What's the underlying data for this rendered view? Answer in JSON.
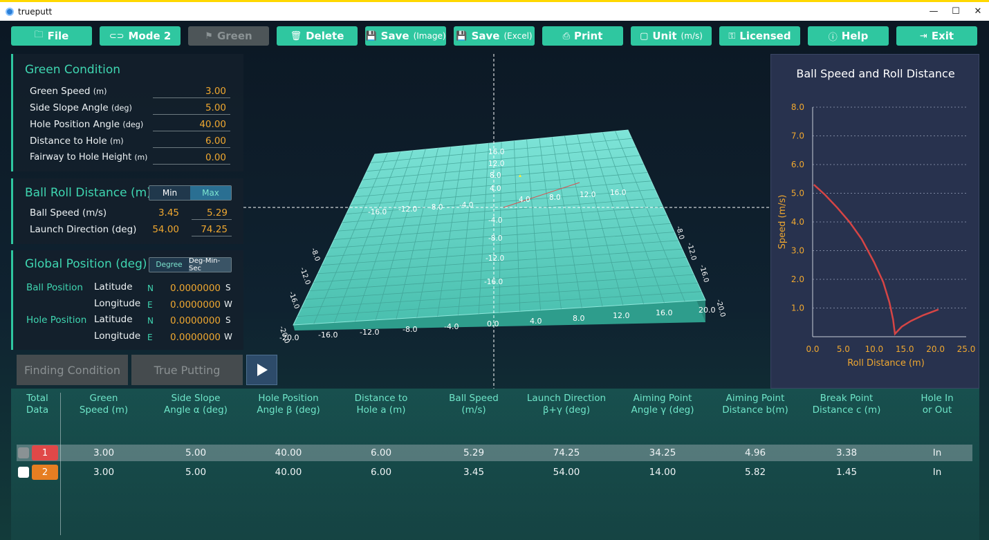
{
  "window": {
    "title": "trueputt",
    "controls": [
      "—",
      "☐",
      "✕"
    ]
  },
  "toolbar": {
    "file": "File",
    "mode": "Mode 2",
    "green": "Green",
    "delete": "Delete",
    "save_image": "Save",
    "save_image_sub": "(Image)",
    "save_excel": "Save",
    "save_excel_sub": "(Excel)",
    "print": "Print",
    "unit": "Unit",
    "unit_sub": "(m/s)",
    "licensed": "Licensed",
    "help": "Help",
    "exit": "Exit"
  },
  "green_condition": {
    "title": "Green Condition",
    "fields": [
      {
        "label": "Green Speed",
        "unit": "(m)",
        "value": "3.00"
      },
      {
        "label": "Side Slope Angle",
        "unit": "(deg)",
        "value": "5.00"
      },
      {
        "label": "Hole Position Angle",
        "unit": "(deg)",
        "value": "40.00"
      },
      {
        "label": "Distance to Hole",
        "unit": "(m)",
        "value": "6.00"
      },
      {
        "label": "Fairway to Hole Height",
        "unit": "(m)",
        "value": "0.00"
      }
    ]
  },
  "ball_roll": {
    "title": "Ball Roll Distance (m)",
    "min_label": "Min",
    "max_label": "Max",
    "rows": [
      {
        "label": "Ball Speed (m/s)",
        "min": "3.45",
        "max": "5.29"
      },
      {
        "label": "Launch Direction (deg)",
        "min": "54.00",
        "max": "74.25"
      }
    ]
  },
  "global_position": {
    "title": "Global Position (deg)",
    "degree_label": "Degree",
    "dms_label": "Deg-Min-Sec",
    "ball_label": "Ball Position",
    "hole_label": "Hole Position",
    "latitude": "Latitude",
    "longitude": "Longitude",
    "N": "N",
    "E": "E",
    "S": "S",
    "W": "W",
    "ball_lat": "0.0000000",
    "ball_lon": "0.0000000",
    "hole_lat": "0.0000000",
    "hole_lon": "0.0000000"
  },
  "actions": {
    "finding": "Finding Condition",
    "true_putting": "True Putting"
  },
  "view3d": {
    "x_labels": [
      "-20.0",
      "-16.0",
      "-12.0",
      "-8.0",
      "-4.0",
      "0.0",
      "4.0",
      "8.0",
      "12.0",
      "16.0",
      "20.0"
    ],
    "inner_x": [
      "-16.0",
      "-12.0",
      "-8.0",
      "-4.0",
      "4.0",
      "8.0",
      "12.0",
      "16.0"
    ],
    "inner_y": [
      "16.0",
      "12.0",
      "8.0",
      "4.0",
      "-4.0",
      "-8.0",
      "-12.0",
      "-16.0"
    ],
    "left_edge": [
      "-20.0",
      "-16.0",
      "-12.0",
      "-8.0"
    ],
    "right_edge": [
      "-20.0",
      "-16.0",
      "-12.0",
      "-8.0",
      "8",
      "12",
      "16"
    ]
  },
  "chart_data": {
    "type": "line",
    "title": "Ball Speed and Roll Distance",
    "xlabel": "Roll Distance (m)",
    "ylabel": "Speed (m/s)",
    "xlim": [
      0,
      25
    ],
    "ylim": [
      0,
      8
    ],
    "xticks": [
      "0.0",
      "5.0",
      "10.0",
      "15.0",
      "20.0",
      "25.0"
    ],
    "yticks": [
      "1.0",
      "2.0",
      "3.0",
      "4.0",
      "5.0",
      "6.0",
      "7.0",
      "8.0"
    ],
    "grid": true,
    "series": [
      {
        "color": "#d64545",
        "x": [
          0.2,
          2.0,
          4.0,
          6.0,
          8.0,
          10.0,
          11.5,
          12.5,
          13.1,
          13.4,
          14.5,
          16.0,
          18.0,
          20.5
        ],
        "y": [
          5.3,
          4.95,
          4.5,
          4.0,
          3.4,
          2.6,
          1.9,
          1.2,
          0.6,
          0.1,
          0.35,
          0.55,
          0.75,
          0.95
        ]
      }
    ]
  },
  "table": {
    "headers": [
      [
        "Total",
        "Data"
      ],
      [
        "Green",
        "Speed (m)"
      ],
      [
        "Side Slope",
        "Angle α (deg)"
      ],
      [
        "Hole Position",
        "Angle β (deg)"
      ],
      [
        "Distance to",
        "Hole a (m)"
      ],
      [
        "Ball Speed",
        "(m/s)"
      ],
      [
        "Launch Direction",
        "β+γ (deg)"
      ],
      [
        "Aiming Point",
        "Angle γ (deg)"
      ],
      [
        "Aiming Point",
        "Distance b(m)"
      ],
      [
        "Break Point",
        "Distance c  (m)"
      ],
      [
        "Hole In",
        "or Out"
      ]
    ],
    "rows": [
      {
        "id": "1",
        "badge_color": "#e04848",
        "cells": [
          "3.00",
          "5.00",
          "40.00",
          "6.00",
          "5.29",
          "74.25",
          "34.25",
          "4.96",
          "3.38",
          "In"
        ]
      },
      {
        "id": "2",
        "badge_color": "#e67e22",
        "cells": [
          "3.00",
          "5.00",
          "40.00",
          "6.00",
          "3.45",
          "54.00",
          "14.00",
          "5.82",
          "1.45",
          "In"
        ]
      }
    ]
  },
  "colors": {
    "accent": "#2fc7a0",
    "value": "#f0a830",
    "green_surface": "#5ed2c4"
  }
}
